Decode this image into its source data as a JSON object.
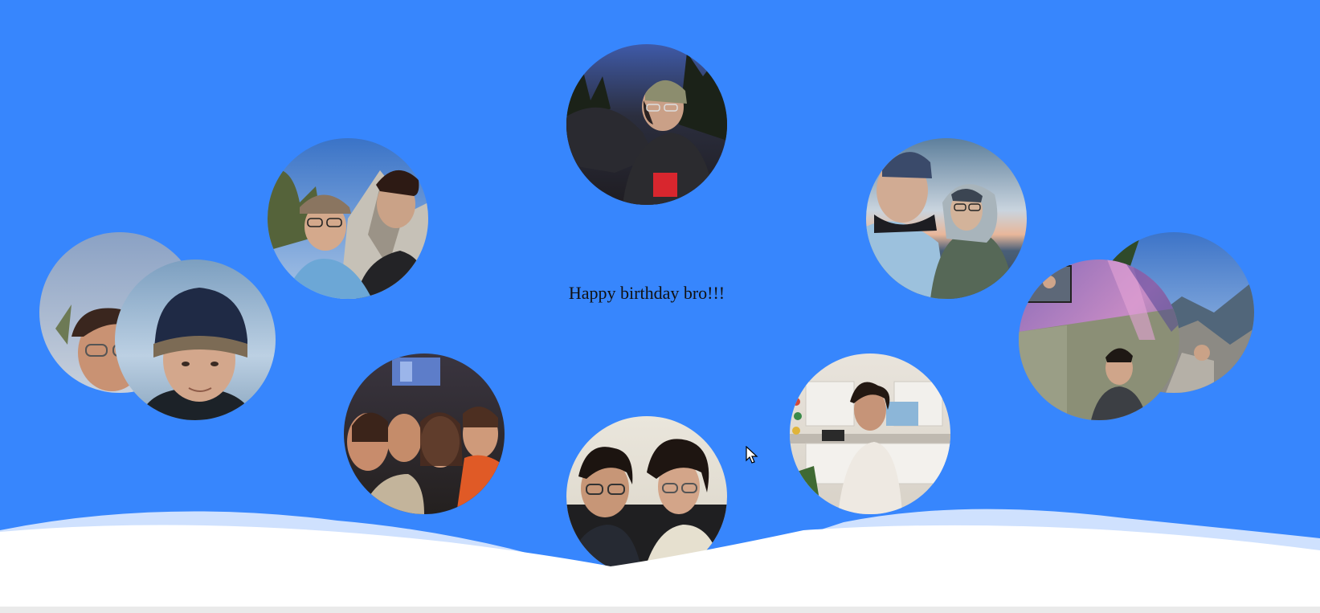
{
  "greeting": "Happy birthday bro!!!",
  "colors": {
    "background": "#3786fd",
    "snow": "#ffffff",
    "snow_shadow": "#cfe1fe"
  },
  "photos": [
    {
      "name": "photo-top-center",
      "subject": "selfie at dusk with beanie"
    },
    {
      "name": "photo-upper-left",
      "subject": "two friends hiking on rocky mountain"
    },
    {
      "name": "photo-upper-right",
      "subject": "two friends in winter jackets at sunset"
    },
    {
      "name": "photo-left-back",
      "subject": "friend with glasses"
    },
    {
      "name": "photo-left-front",
      "subject": "close selfie with knit beanie"
    },
    {
      "name": "photo-right-back",
      "subject": "person on mountain cliff"
    },
    {
      "name": "photo-right-front",
      "subject": "person looking up at light show"
    },
    {
      "name": "photo-lower-left",
      "subject": "group selfie of four"
    },
    {
      "name": "photo-lower-right",
      "subject": "person standing in kitchen"
    },
    {
      "name": "photo-bottom-center",
      "subject": "two friends on a couch"
    }
  ]
}
